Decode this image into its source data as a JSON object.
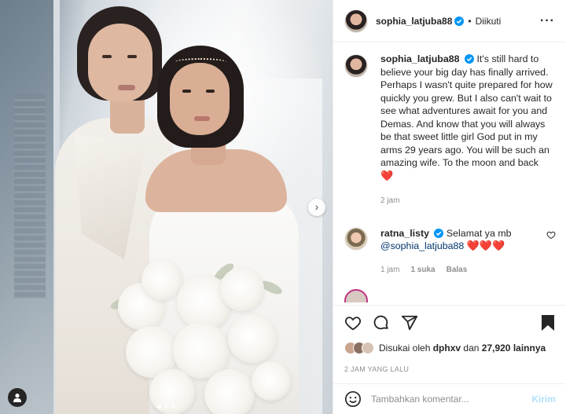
{
  "post": {
    "username": "sophia_latjuba88",
    "follow_status": "Diikuti",
    "more_icon": "more-horizontal-icon"
  },
  "caption": {
    "username": "sophia_latjuba88",
    "text": "It's still hard to believe your big day has finally arrived. Perhaps I wasn't quite prepared for how quickly you grew. But I also can't wait to see what adventures await for you and Demas. And know that you will always be that sweet little girl God put in my arms 29 years ago. You will be such an amazing wife. To the moon and back",
    "emoji": "❤️",
    "time": "2 jam"
  },
  "comments": [
    {
      "username": "ratna_listy",
      "text": "Selamat ya mb",
      "mention": "@sophia_latjuba88",
      "emoji": "❤️❤️❤️",
      "time": "1 jam",
      "likes": "1 suka",
      "reply": "Balas"
    }
  ],
  "likes": {
    "prefix": "Disukai oleh",
    "user": "dphxv",
    "connector": "dan",
    "count": "27,920 lainnya"
  },
  "timestamp": "2 JAM YANG LALU",
  "comment_box": {
    "placeholder": "Tambahkan komentar...",
    "send_label": "Kirim"
  },
  "colors": {
    "verified": "#0095f6",
    "heart": "#d0021b",
    "link": "#00376b",
    "send_disabled": "#b2dffc"
  },
  "carousel": {
    "next_icon": "chevron-right-icon",
    "slides": 3,
    "active_slide": 1
  }
}
